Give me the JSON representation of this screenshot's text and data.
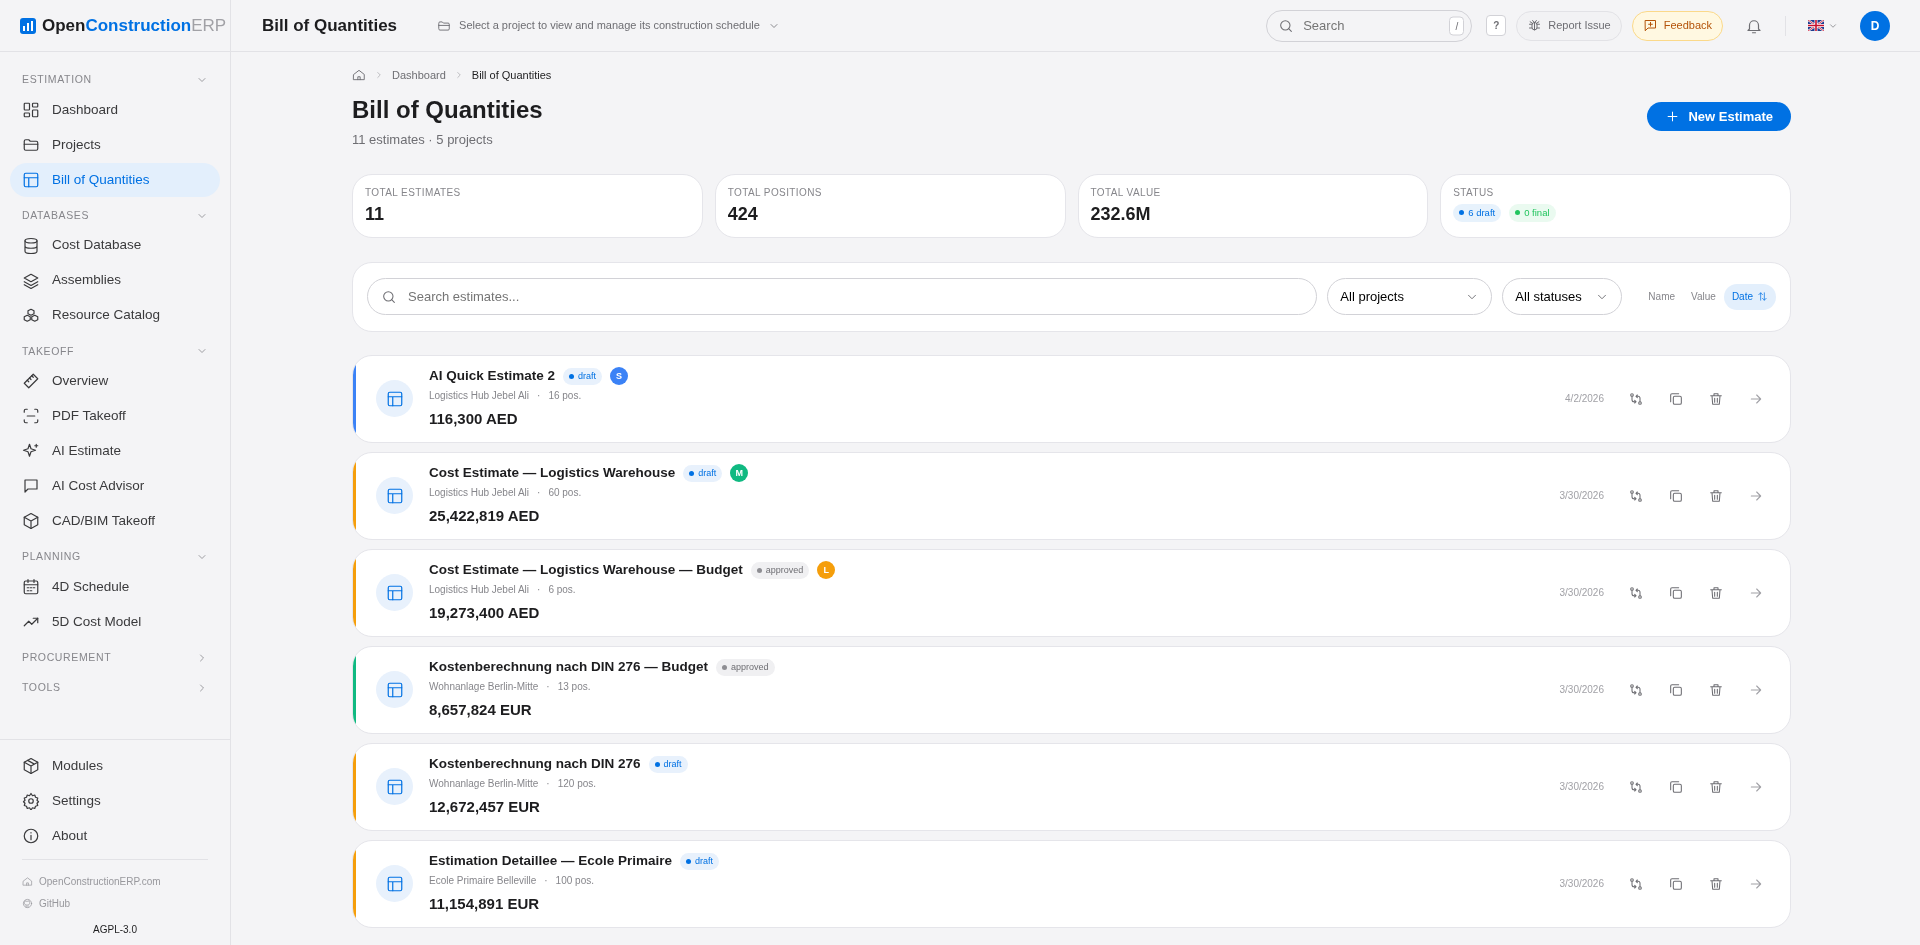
{
  "brand": {
    "part_1": "Open",
    "part_2": "Construction",
    "part_3": "ERP"
  },
  "sidebar": {
    "sections": [
      {
        "title": "ESTIMATION",
        "expanded": true,
        "items": [
          {
            "label": "Dashboard",
            "selected": false
          },
          {
            "label": "Projects",
            "selected": false
          },
          {
            "label": "Bill of Quantities",
            "selected": true
          }
        ]
      },
      {
        "title": "DATABASES",
        "expanded": true,
        "items": [
          {
            "label": "Cost Database",
            "selected": false
          },
          {
            "label": "Assemblies",
            "selected": false
          },
          {
            "label": "Resource Catalog",
            "selected": false
          }
        ]
      },
      {
        "title": "TAKEOFF",
        "expanded": true,
        "items": [
          {
            "label": "Overview",
            "selected": false
          },
          {
            "label": "PDF Takeoff",
            "selected": false
          },
          {
            "label": "AI Estimate",
            "selected": false
          },
          {
            "label": "AI Cost Advisor",
            "selected": false
          },
          {
            "label": "CAD/BIM Takeoff",
            "selected": false
          }
        ]
      },
      {
        "title": "PLANNING",
        "expanded": true,
        "items": [
          {
            "label": "4D Schedule",
            "selected": false
          },
          {
            "label": "5D Cost Model",
            "selected": false
          }
        ]
      },
      {
        "title": "PROCUREMENT",
        "expanded": false
      },
      {
        "title": "TOOLS",
        "expanded": false
      }
    ],
    "bottom_items": [
      {
        "label": "Modules"
      },
      {
        "label": "Settings"
      },
      {
        "label": "About"
      }
    ],
    "links": [
      {
        "label": "OpenConstructionERP.com"
      },
      {
        "label": "GitHub"
      }
    ],
    "license": "AGPL-3.0"
  },
  "header": {
    "title": "Bill of Quantities",
    "project_selector": "Select a project to view and manage its construction schedule",
    "search_placeholder": "Search",
    "search_shortcut": "/",
    "help": "?",
    "report_issue": "Report Issue",
    "feedback": "Feedback",
    "avatar": "D"
  },
  "breadcrumb": [
    "Dashboard",
    "Bill of Quantities"
  ],
  "page": {
    "title": "Bill of Quantities",
    "subtitle": "11 estimates · 5 projects",
    "new_button": "New Estimate"
  },
  "stats": [
    {
      "label": "TOTAL ESTIMATES",
      "value": "11"
    },
    {
      "label": "TOTAL POSITIONS",
      "value": "424"
    },
    {
      "label": "TOTAL VALUE",
      "value": "232.6M"
    }
  ],
  "status_card": {
    "label": "STATUS",
    "chips": [
      {
        "text": "6 draft",
        "color": "#0071e3"
      },
      {
        "text": "0 final",
        "color": "#22c55e"
      }
    ]
  },
  "filters": {
    "search_placeholder": "Search estimates...",
    "project": "All projects",
    "status": "All statuses",
    "sort": [
      {
        "label": "Name",
        "selected": false
      },
      {
        "label": "Value",
        "selected": false
      },
      {
        "label": "Date",
        "selected": true
      }
    ]
  },
  "estimates": [
    {
      "title": "AI Quick Estimate 2",
      "status": "draft",
      "avatar": {
        "letter": "S",
        "color": "#3b82f6"
      },
      "color": "#3b82f6",
      "project": "Logistics Hub Jebel Ali",
      "separator": "·",
      "positions": "16 pos.",
      "total": "116,300 AED",
      "date": "4/2/2026"
    },
    {
      "title": "Cost Estimate — Logistics Warehouse",
      "status": "draft",
      "avatar": {
        "letter": "M",
        "color": "#10b981"
      },
      "color": "#f59e0b",
      "project": "Logistics Hub Jebel Ali",
      "separator": "·",
      "positions": "60 pos.",
      "total": "25,422,819 AED",
      "date": "3/30/2026"
    },
    {
      "title": "Cost Estimate — Logistics Warehouse — Budget",
      "status": "approved",
      "avatar": {
        "letter": "L",
        "color": "#f59e0b"
      },
      "color": "#f59e0b",
      "project": "Logistics Hub Jebel Ali",
      "separator": "·",
      "positions": "6 pos.",
      "total": "19,273,400 AED",
      "date": "3/30/2026"
    },
    {
      "title": "Kostenberechnung nach DIN 276 — Budget",
      "status": "approved",
      "color": "#10b981",
      "project": "Wohnanlage Berlin-Mitte",
      "separator": "·",
      "positions": "13 pos.",
      "total": "8,657,824 EUR",
      "date": "3/30/2026"
    },
    {
      "title": "Kostenberechnung nach DIN 276",
      "status": "draft",
      "color": "#f59e0b",
      "project": "Wohnanlage Berlin-Mitte",
      "separator": "·",
      "positions": "120 pos.",
      "total": "12,672,457 EUR",
      "date": "3/30/2026"
    },
    {
      "title": "Estimation Detaillee — Ecole Primaire",
      "status": "draft",
      "color": "#f59e0b",
      "project": "Ecole Primaire Belleville",
      "separator": "·",
      "positions": "100 pos.",
      "total": "11,154,891 EUR",
      "date": "3/30/2026"
    }
  ]
}
